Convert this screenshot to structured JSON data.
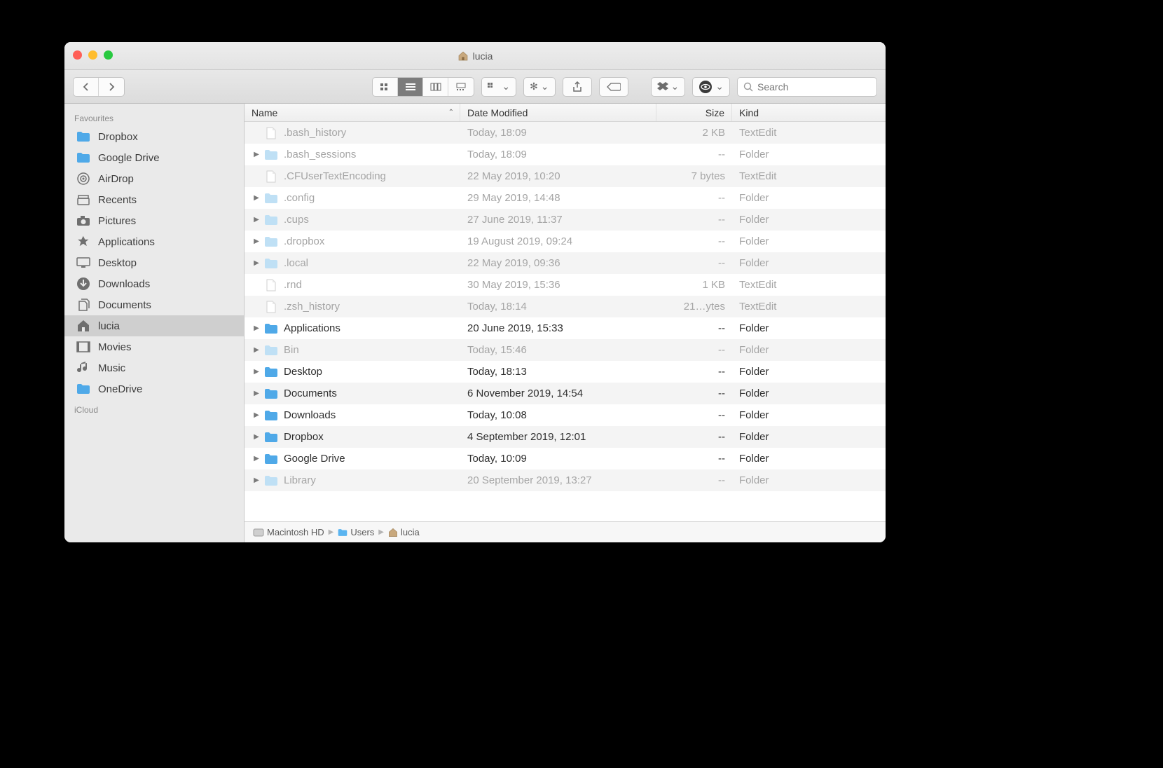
{
  "window": {
    "title": "lucia"
  },
  "search": {
    "placeholder": "Search"
  },
  "sidebar": {
    "sections": [
      {
        "label": "Favourites",
        "items": [
          {
            "label": "Dropbox",
            "icon": "folder"
          },
          {
            "label": "Google Drive",
            "icon": "folder"
          },
          {
            "label": "AirDrop",
            "icon": "airdrop"
          },
          {
            "label": "Recents",
            "icon": "recents"
          },
          {
            "label": "Pictures",
            "icon": "camera"
          },
          {
            "label": "Applications",
            "icon": "apps"
          },
          {
            "label": "Desktop",
            "icon": "desktop"
          },
          {
            "label": "Downloads",
            "icon": "downloads"
          },
          {
            "label": "Documents",
            "icon": "documents"
          },
          {
            "label": "lucia",
            "icon": "home",
            "selected": true
          },
          {
            "label": "Movies",
            "icon": "movies"
          },
          {
            "label": "Music",
            "icon": "music"
          },
          {
            "label": "OneDrive",
            "icon": "folder"
          }
        ]
      },
      {
        "label": "iCloud",
        "items": []
      }
    ]
  },
  "columns": {
    "name": "Name",
    "date": "Date Modified",
    "size": "Size",
    "kind": "Kind"
  },
  "files": [
    {
      "name": ".bash_history",
      "date": "Today, 18:09",
      "size": "2 KB",
      "kind": "TextEdit",
      "dim": true,
      "expandable": false,
      "icon": "doc"
    },
    {
      "name": ".bash_sessions",
      "date": "Today, 18:09",
      "size": "--",
      "kind": "Folder",
      "dim": true,
      "expandable": true,
      "icon": "folder-light"
    },
    {
      "name": ".CFUserTextEncoding",
      "date": "22 May 2019, 10:20",
      "size": "7 bytes",
      "kind": "TextEdit",
      "dim": true,
      "expandable": false,
      "icon": "doc"
    },
    {
      "name": ".config",
      "date": "29 May 2019, 14:48",
      "size": "--",
      "kind": "Folder",
      "dim": true,
      "expandable": true,
      "icon": "folder-light"
    },
    {
      "name": ".cups",
      "date": "27 June 2019, 11:37",
      "size": "--",
      "kind": "Folder",
      "dim": true,
      "expandable": true,
      "icon": "folder-light"
    },
    {
      "name": ".dropbox",
      "date": "19 August 2019, 09:24",
      "size": "--",
      "kind": "Folder",
      "dim": true,
      "expandable": true,
      "icon": "folder-light"
    },
    {
      "name": ".local",
      "date": "22 May 2019, 09:36",
      "size": "--",
      "kind": "Folder",
      "dim": true,
      "expandable": true,
      "icon": "folder-light"
    },
    {
      "name": ".rnd",
      "date": "30 May 2019, 15:36",
      "size": "1 KB",
      "kind": "TextEdit",
      "dim": true,
      "expandable": false,
      "icon": "doc"
    },
    {
      "name": ".zsh_history",
      "date": "Today, 18:14",
      "size": "21…ytes",
      "kind": "TextEdit",
      "dim": true,
      "expandable": false,
      "icon": "doc"
    },
    {
      "name": "Applications",
      "date": "20 June 2019, 15:33",
      "size": "--",
      "kind": "Folder",
      "dim": false,
      "expandable": true,
      "icon": "folder-apps"
    },
    {
      "name": "Bin",
      "date": "Today, 15:46",
      "size": "--",
      "kind": "Folder",
      "dim": true,
      "expandable": true,
      "icon": "folder-light"
    },
    {
      "name": "Desktop",
      "date": "Today, 18:13",
      "size": "--",
      "kind": "Folder",
      "dim": false,
      "expandable": true,
      "icon": "folder"
    },
    {
      "name": "Documents",
      "date": "6 November 2019, 14:54",
      "size": "--",
      "kind": "Folder",
      "dim": false,
      "expandable": true,
      "icon": "folder"
    },
    {
      "name": "Downloads",
      "date": "Today, 10:08",
      "size": "--",
      "kind": "Folder",
      "dim": false,
      "expandable": true,
      "icon": "folder-dl"
    },
    {
      "name": "Dropbox",
      "date": "4 September 2019, 12:01",
      "size": "--",
      "kind": "Folder",
      "dim": false,
      "expandable": true,
      "icon": "folder-db"
    },
    {
      "name": "Google Drive",
      "date": "Today, 10:09",
      "size": "--",
      "kind": "Folder",
      "dim": false,
      "expandable": true,
      "icon": "folder-gd"
    },
    {
      "name": "Library",
      "date": "20 September 2019, 13:27",
      "size": "--",
      "kind": "Folder",
      "dim": true,
      "expandable": true,
      "icon": "folder-light"
    }
  ],
  "pathbar": [
    {
      "label": "Macintosh HD",
      "icon": "disk"
    },
    {
      "label": "Users",
      "icon": "folder"
    },
    {
      "label": "lucia",
      "icon": "home"
    }
  ]
}
